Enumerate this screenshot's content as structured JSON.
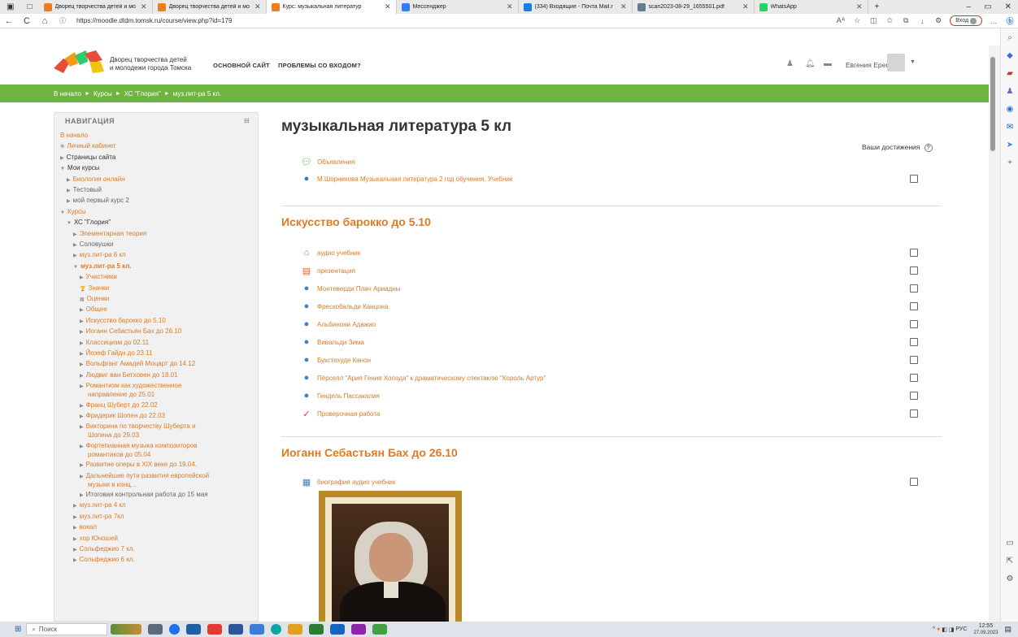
{
  "browser": {
    "tabs": [
      {
        "title": "Дворец творчества детей и мо",
        "color": "#e67e22"
      },
      {
        "title": "Дворец творчества детей и мо",
        "color": "#e67e22"
      },
      {
        "title": "Курс: музыкальная литератур",
        "color": "#e67e22",
        "active": true
      },
      {
        "title": "Мессенджер",
        "color": "#2d7ff9"
      },
      {
        "title": "(334) Входящие - Почта Mail.r",
        "color": "#1b7ee0"
      },
      {
        "title": "scan2023-08-29_1655501.pdf",
        "color": "#607d8b"
      },
      {
        "title": "WhatsApp",
        "color": "#25d366"
      }
    ],
    "new_tab": "+",
    "url": "https://moodle.dtdm.tomsk.ru/course/view.php?id=179",
    "login_label": "Вход",
    "back": "←",
    "refresh": "C",
    "home": "⌂"
  },
  "site": {
    "name_line1": "Дворец творчества детей",
    "name_line2": "и молодежи города Томска",
    "nav_main": "ОСНОВНОЙ САЙТ",
    "nav_login": "ПРОБЛЕМЫ СО ВХОДОМ?",
    "user_name": "Евгения Еремина"
  },
  "breadcrumb": [
    "В начало",
    "Курсы",
    "ХС \"Глория\"",
    "муз.лит-ра 5 кл."
  ],
  "nav": {
    "title": "НАВИГАЦИЯ",
    "items": [
      {
        "label": "В начало",
        "indent": 0,
        "style": "orange",
        "arrow": ""
      },
      {
        "label": "Личный кабинет",
        "indent": 0,
        "style": "orange",
        "arrow": "☸"
      },
      {
        "label": "Страницы сайта",
        "indent": 0,
        "style": "dark",
        "arrow": "▶"
      },
      {
        "label": "Мои курсы",
        "indent": 0,
        "style": "dark",
        "arrow": "▼"
      },
      {
        "label": "Биология онлайн",
        "indent": 1,
        "style": "orange",
        "arrow": "▶"
      },
      {
        "label": "Тестовый",
        "indent": 1,
        "style": "grey",
        "arrow": "▶"
      },
      {
        "label": "мой первый курс 2",
        "indent": 1,
        "style": "grey",
        "arrow": "▶"
      },
      {
        "label": "Курсы",
        "indent": 0,
        "style": "orange",
        "arrow": "▼"
      },
      {
        "label": "ХС \"Глория\"",
        "indent": 1,
        "style": "dark",
        "arrow": "▼"
      },
      {
        "label": "Элементарная теория",
        "indent": 2,
        "style": "orange",
        "arrow": "▶"
      },
      {
        "label": "Соловушки",
        "indent": 2,
        "style": "grey",
        "arrow": "▶"
      },
      {
        "label": "муз.лит-ра 6 кл",
        "indent": 2,
        "style": "orange",
        "arrow": "▶"
      },
      {
        "label": "муз.лит-ра 5 кл.",
        "indent": 2,
        "style": "orange bold",
        "arrow": "▼"
      },
      {
        "label": "Участники",
        "indent": 3,
        "style": "orange",
        "arrow": "▶"
      },
      {
        "label": "Значки",
        "indent": 3,
        "style": "orange",
        "arrow": "🏆"
      },
      {
        "label": "Оценки",
        "indent": 3,
        "style": "orange",
        "arrow": "▦"
      },
      {
        "label": "Общее",
        "indent": 3,
        "style": "orange",
        "arrow": "▶"
      },
      {
        "label": "Искусство барокко до 5.10",
        "indent": 3,
        "style": "orange",
        "arrow": "▶"
      },
      {
        "label": "Иоганн Себастьян Бах до 26.10",
        "indent": 3,
        "style": "orange",
        "arrow": "▶"
      },
      {
        "label": "Классицизм до 02.11",
        "indent": 3,
        "style": "orange",
        "arrow": "▶"
      },
      {
        "label": "Йозеф Гайдн до 23.11",
        "indent": 3,
        "style": "orange",
        "arrow": "▶"
      },
      {
        "label": "Вольфганг Амадей Моцарт до 14.12",
        "indent": 3,
        "style": "orange",
        "arrow": "▶"
      },
      {
        "label": "Людвиг ван Бетховен до 18.01",
        "indent": 3,
        "style": "orange",
        "arrow": "▶"
      },
      {
        "label": "Романтизм как художественное",
        "label2": "направление до 25.01",
        "indent": 3,
        "style": "orange",
        "arrow": "▶"
      },
      {
        "label": "Франц Шуберт до 22.02",
        "indent": 3,
        "style": "orange",
        "arrow": "▶"
      },
      {
        "label": "Фридерик Шопен до 22.03",
        "indent": 3,
        "style": "orange",
        "arrow": "▶"
      },
      {
        "label": "Викторина по творчеству Шуберта и",
        "label2": "Шопена до 29.03",
        "indent": 3,
        "style": "orange",
        "arrow": "▶"
      },
      {
        "label": "Фортепианная музыка композиторов",
        "label2": "романтиков до 05.04",
        "indent": 3,
        "style": "orange",
        "arrow": "▶"
      },
      {
        "label": "Развитие оперы в XIX веке до 19.04.",
        "indent": 3,
        "style": "orange",
        "arrow": "▶"
      },
      {
        "label": "Дальнейшие пути развития европейской",
        "label2": "музыки в конц...",
        "indent": 3,
        "style": "orange",
        "arrow": "▶"
      },
      {
        "label": "Итоговая контрольная работа до 15 мая",
        "indent": 3,
        "style": "grey",
        "arrow": "▶"
      },
      {
        "label": "муз.лит-ра 4 кл",
        "indent": 2,
        "style": "orange",
        "arrow": "▶"
      },
      {
        "label": "муз.лит-ра 7кл",
        "indent": 2,
        "style": "orange",
        "arrow": "▶"
      },
      {
        "label": "вокал",
        "indent": 2,
        "style": "orange",
        "arrow": "▶"
      },
      {
        "label": "хор Юношей",
        "indent": 2,
        "style": "orange",
        "arrow": "▶"
      },
      {
        "label": "Сольфеджио 7 кл.",
        "indent": 2,
        "style": "orange",
        "arrow": "▶"
      },
      {
        "label": "Сольфеджио 6 кл.",
        "indent": 2,
        "style": "orange",
        "arrow": "▶"
      }
    ]
  },
  "main": {
    "title": "музыкальная литература 5 кл",
    "achievements_label": "Ваши достижения",
    "general": [
      {
        "label": "Объявления",
        "icon": "forum-icon",
        "color": "#4caf50",
        "checkbox": false
      },
      {
        "label": "М.Шорникова Музыкальная литература 2 год обучения. Учебник",
        "icon": "url-icon",
        "color": "#2e7dd1",
        "checkbox": true
      }
    ],
    "sections": [
      {
        "title": "Искусство барокко до 5.10",
        "items": [
          {
            "label": "аудио учебник",
            "icon": "folder-icon",
            "color": "#4a90c2",
            "checkbox": true
          },
          {
            "label": "презентация",
            "icon": "presentation-icon",
            "color": "#e05a2a",
            "checkbox": true
          },
          {
            "label": "Монтеверди Плач Ариадны",
            "icon": "url-icon",
            "color": "#3f7fc4",
            "checkbox": true
          },
          {
            "label": "Фрескобальди Канцона",
            "icon": "url-icon",
            "color": "#3f7fc4",
            "checkbox": true
          },
          {
            "label": "Альбинони Адажио",
            "icon": "url-icon",
            "color": "#3f7fc4",
            "checkbox": true
          },
          {
            "label": "Вивальди Зима",
            "icon": "url-icon",
            "color": "#3f7fc4",
            "checkbox": true
          },
          {
            "label": "Букстехуде Канон",
            "icon": "url-icon",
            "color": "#3f7fc4",
            "checkbox": true
          },
          {
            "label": "Пёрселл \"Ария Гения Холода\" к драматическому спектаклю \"Король Артур\"",
            "icon": "url-icon",
            "color": "#3f7fc4",
            "checkbox": true
          },
          {
            "label": "Гендель Пассакалия",
            "icon": "url-icon",
            "color": "#3f7fc4",
            "checkbox": true
          },
          {
            "label": "Проверочная работа",
            "icon": "assignment-icon",
            "color": "#d6392b",
            "checkbox": true
          }
        ]
      },
      {
        "title": "Иоганн Себастьян Бах до 26.10",
        "items": [
          {
            "label": "биография аудио учебник",
            "icon": "book-icon",
            "color": "#3f7fc4",
            "checkbox": true
          }
        ]
      }
    ]
  },
  "taskbar": {
    "search_placeholder": "Поиск",
    "lang": "РУС",
    "time": "12:55",
    "date": "27.09.2023"
  },
  "colors": {
    "accent_orange": "#e07a22",
    "breadcrumb_green": "#6fb43e"
  }
}
